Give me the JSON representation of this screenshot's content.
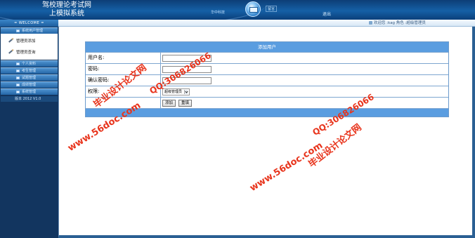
{
  "header": {
    "title_line1": "驾校理论考试网",
    "title_line2": "上模拟系统",
    "link1": "华中科技",
    "link2": "留言",
    "logout": "退出"
  },
  "welcome_bar": {
    "label": "= WELCOME =",
    "user_info": "欢迎您 :kag 角色 :超级管理员"
  },
  "sidebar": {
    "menus": [
      {
        "label": "系统用户管理"
      },
      {
        "label": "个人资料"
      },
      {
        "label": "考生管理"
      },
      {
        "label": "试题管理"
      },
      {
        "label": "成绩管理"
      },
      {
        "label": "系统管理"
      }
    ],
    "sub_items": [
      {
        "label": "管理员添加"
      },
      {
        "label": "管理员查询"
      }
    ],
    "version": "版本 2012 V1.0"
  },
  "form": {
    "title": "添加用户",
    "fields": [
      {
        "label": "用户名:",
        "value": ""
      },
      {
        "label": "密码:",
        "value": ""
      },
      {
        "label": "确认密码:",
        "value": ""
      }
    ],
    "permission_label": "权限:",
    "permission_selected": "超级管理员",
    "add_button": "添加",
    "reset_button": "重填"
  },
  "watermarks": {
    "site": "www.56doc.com",
    "brand": "毕业设计论文网",
    "qq": "QQ:306826066"
  },
  "colors": {
    "header_blue": "#1560a6",
    "form_header_blue": "#5a9de0",
    "watermark_red": "#e8341c"
  }
}
